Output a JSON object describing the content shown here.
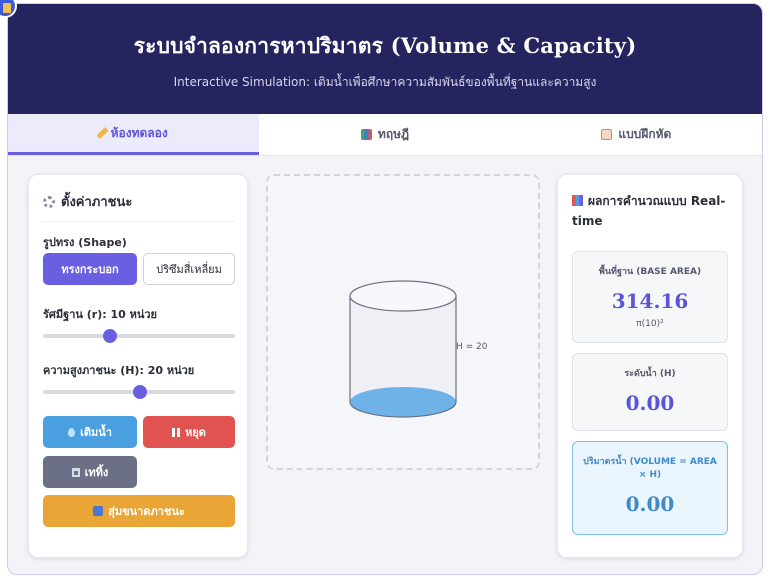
{
  "header": {
    "title": "ระบบจำลองการหาปริมาตร (Volume & Capacity)",
    "subtitle": "Interactive Simulation: เติมน้ำเพื่อศึกษาความสัมพันธ์ของพื้นที่ฐานและความสูง"
  },
  "tabs": [
    {
      "label": "ห้องทดลอง",
      "icon": "pencil-icon",
      "active": true
    },
    {
      "label": "ทฤษฎี",
      "icon": "book-icon",
      "active": false
    },
    {
      "label": "แบบฝึกหัด",
      "icon": "memo-icon",
      "active": false
    }
  ],
  "settings": {
    "title": "ตั้งค่าภาชนะ",
    "shape_label": "รูปทรง (Shape)",
    "shape_options": [
      "ทรงกระบอก",
      "ปริซึมสี่เหลี่ยม"
    ],
    "selected_shape": "ทรงกระบอก",
    "radius_label": "รัศมีฐาน (r): 10 หน่วย",
    "radius_value": 10,
    "height_label": "ความสูงภาชนะ (H): 20 หน่วย",
    "height_value": 20,
    "fill_button": "เติมน้ำ",
    "stop_button": "หยุด",
    "empty_button": "เททิ้ง",
    "random_button": "สุ่มขนาดภาชนะ"
  },
  "stage": {
    "height_tag": "H = 20",
    "water_level": 0
  },
  "results": {
    "title": "ผลการคำนวณแบบ Real-time",
    "base_area_label": "พื้นที่ฐาน (BASE AREA)",
    "base_area_value": "314.16",
    "base_area_formula": "π(10)²",
    "water_level_label": "ระดับน้ำ (H)",
    "water_level_value": "0.00",
    "volume_label": "ปริมาตรน้ำ (VOLUME = AREA × H)",
    "volume_value": "0.00"
  },
  "colors": {
    "header_bg": "#26245e",
    "accent": "#6a5fe0",
    "fill_button": "#4a9fe0",
    "stop_button": "#e05350",
    "empty_button": "#6b7086",
    "random_button": "#e9a637",
    "water": "#6fb2e8"
  }
}
